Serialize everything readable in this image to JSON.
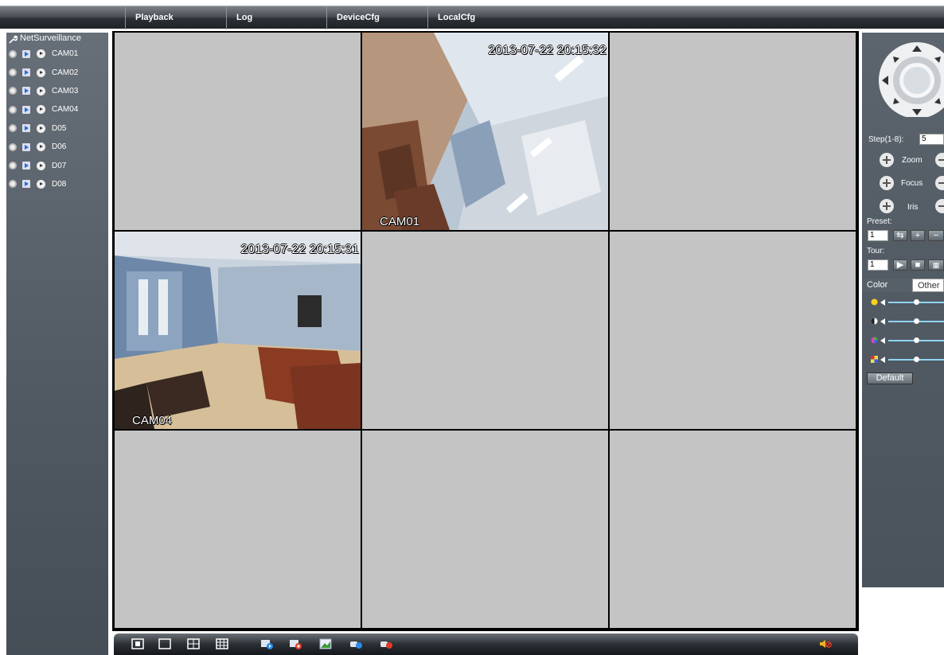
{
  "menu": [
    "Playback",
    "Log",
    "DeviceCfg",
    "LocalCfg"
  ],
  "tree": {
    "root_label": "NetSurveillance",
    "channels": [
      "CAM01",
      "CAM02",
      "CAM03",
      "CAM04",
      "D05",
      "D06",
      "D07",
      "D08"
    ]
  },
  "grid": {
    "cells": [
      {
        "name": "",
        "time": ""
      },
      {
        "name": "CAM01",
        "time": "2013-07-22 20:15:32"
      },
      {
        "name": "",
        "time": ""
      },
      {
        "name": "CAM04",
        "time": "2013-07-22 20:15:31"
      },
      {
        "name": "",
        "time": ""
      },
      {
        "name": "",
        "time": ""
      },
      {
        "name": "",
        "time": ""
      },
      {
        "name": "",
        "time": ""
      },
      {
        "name": "",
        "time": ""
      }
    ]
  },
  "ptz": {
    "step_label": "Step(1-8):",
    "step_value": "5",
    "zoom_label": "Zoom",
    "focus_label": "Focus",
    "iris_label": "Iris",
    "preset_label": "Preset:",
    "preset_value": "1",
    "tour_label": "Tour:",
    "tour_value": "1",
    "tabs": [
      "Color",
      "Other"
    ],
    "sliders": [
      {
        "icon": "brightness-icon",
        "level": 0.5
      },
      {
        "icon": "contrast-icon",
        "level": 0.5
      },
      {
        "icon": "saturation-icon",
        "level": 0.5
      },
      {
        "icon": "hue-icon",
        "level": 0.5
      }
    ],
    "default_label": "Default"
  },
  "toolbar": {
    "icons": [
      "fullscreen-icon",
      "single-view-icon",
      "quad-view-icon",
      "nine-view-icon",
      "start-all-icon",
      "stop-all-icon",
      "snapshot-icon",
      "record-icon",
      "stop-record-icon",
      "mute-icon"
    ]
  },
  "colors": {
    "active_border": "#2e9b2e",
    "empty_cell": "#c4c4c4",
    "slider_track": "#8fd3f5"
  }
}
